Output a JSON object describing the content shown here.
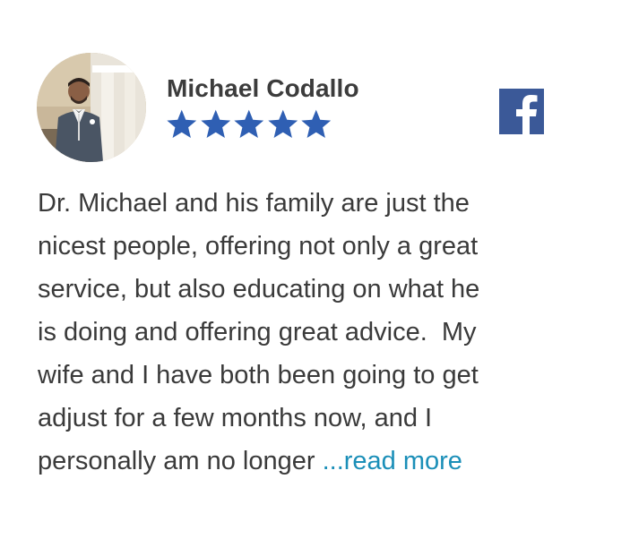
{
  "review": {
    "reviewer_name": "Michael Codallo",
    "rating": 5,
    "rating_max": 5,
    "source_icon": "facebook-icon",
    "lines": [
      "Dr. Michael and his family are just the",
      "nicest people, offering not only a great",
      "service, but also educating on what he",
      "is doing and offering great advice.  My",
      "wife and I have both been going to get",
      "adjust for a few months now, and I",
      "personally am no longer "
    ],
    "read_more_label": "...read more"
  },
  "colors": {
    "star": "#2f5fb3",
    "facebook": "#3b5998",
    "link": "#1b8fb8",
    "name": "#3c3c3c",
    "text": "#3a3a3a"
  }
}
